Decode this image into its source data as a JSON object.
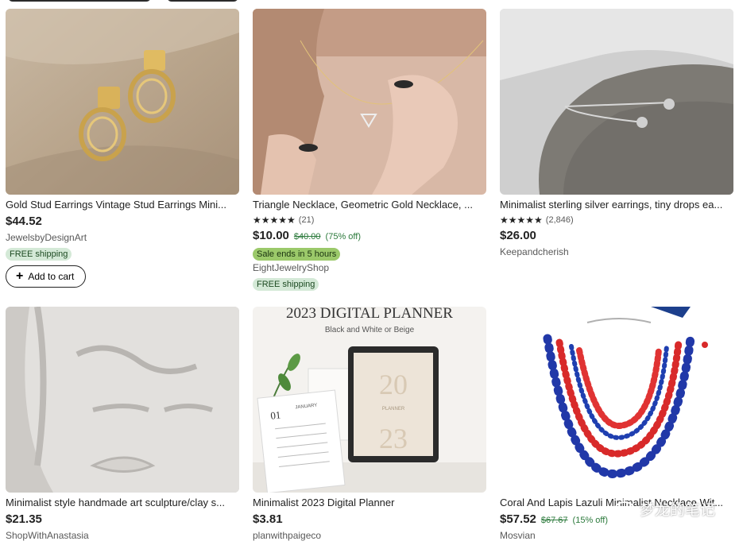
{
  "listings": [
    {
      "title": "Gold Stud Earrings Vintage Stud Earrings Mini...",
      "price": "$44.52",
      "shop": "JewelsbyDesignArt",
      "badge": "FREE shipping",
      "cart_label": "Add to cart",
      "image": "gold-stud-earrings-photo"
    },
    {
      "title": "Triangle Necklace, Geometric Gold Necklace, ...",
      "stars": "★★★★★",
      "reviews": "(21)",
      "price": "$10.00",
      "orig_price": "$40.00",
      "discount": "(75% off)",
      "sale": "Sale ends in 5 hours",
      "shop": "EightJewelryShop",
      "badge": "FREE shipping",
      "image": "triangle-necklace-photo"
    },
    {
      "title": "Minimalist sterling silver earrings, tiny drops ea...",
      "stars": "★★★★★",
      "reviews": "(2,846)",
      "price": "$26.00",
      "shop": "Keepandcherish",
      "image": "silver-earrings-on-stone-photo"
    },
    {
      "title": "Minimalist style handmade art sculpture/clay s...",
      "price": "$21.35",
      "shop": "ShopWithAnastasia",
      "image": "clay-face-sculpture-photo"
    },
    {
      "title": "Minimalist 2023 Digital Planner",
      "price": "$3.81",
      "shop": "planwithpaigeco",
      "image": "digital-planner-mockup",
      "planner_heading": "2023 DIGITAL PLANNER",
      "planner_sub": "Black and White or Beige",
      "cal_month": "JANUARY",
      "cal_num": "01",
      "tablet_a": "20",
      "tablet_b": "23",
      "tablet_label": "PLANNER"
    },
    {
      "title": "Coral And Lapis Lazuli Minimalist Necklace Wit...",
      "price": "$57.52",
      "orig_price": "$67.67",
      "discount": "(15% off)",
      "shop": "Mosvian",
      "image": "coral-lapis-necklace-photo"
    }
  ],
  "watermark": "梦龙的笔记",
  "colors": {
    "discount_green": "#2c7a3c",
    "badge_bg": "#d4e9d7",
    "sale_bg": "#9bc96a"
  }
}
